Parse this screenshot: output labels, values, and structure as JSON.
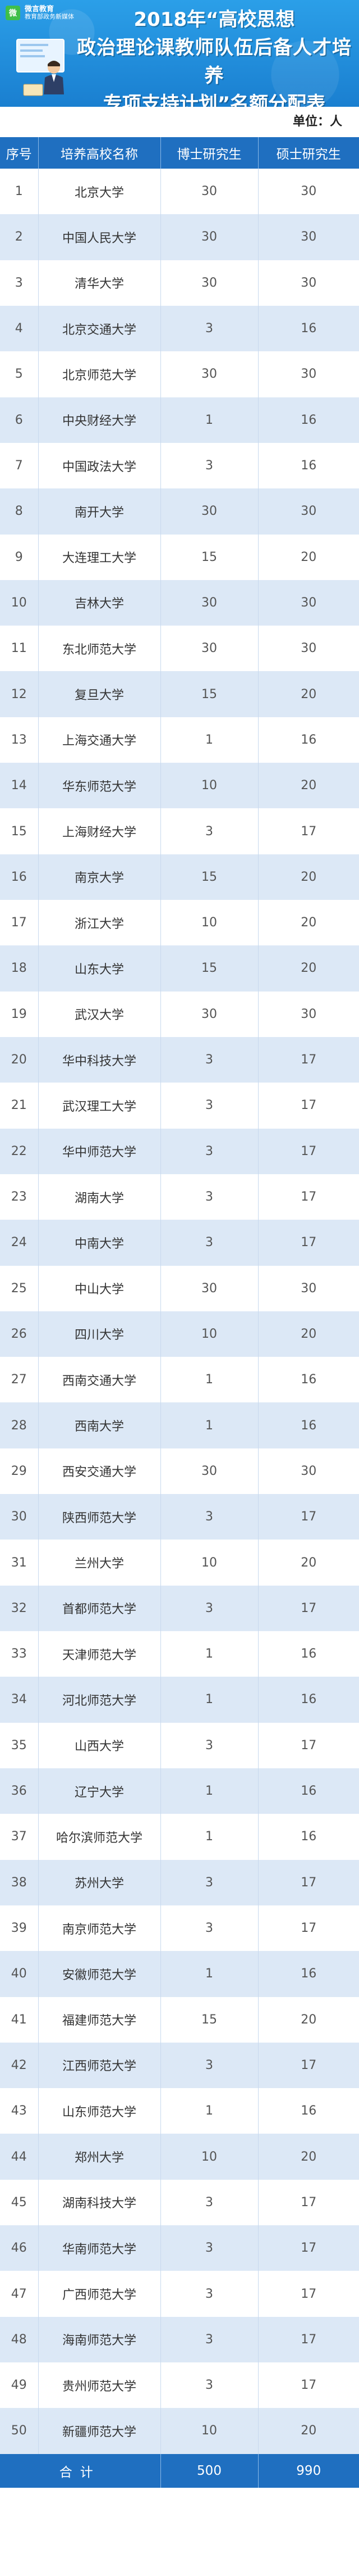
{
  "header": {
    "logo_line1": "微言教育",
    "logo_line2": "教育部政务新媒体",
    "title_line1": "2018年“高校思想",
    "title_line2": "政治理论课教师队伍后备人才培养",
    "title_line3": "专项支持计划”名额分配表",
    "colors": {
      "header_bg": "#1a7fd0",
      "table_header": "#1f6fc0",
      "stripe": "#dce8f6"
    }
  },
  "unit": "单位：人",
  "table": {
    "headers": [
      "序号",
      "培养高校名称",
      "博士研究生",
      "硕士研究生"
    ],
    "rows": [
      [
        "1",
        "北京大学",
        "30",
        "30"
      ],
      [
        "2",
        "中国人民大学",
        "30",
        "30"
      ],
      [
        "3",
        "清华大学",
        "30",
        "30"
      ],
      [
        "4",
        "北京交通大学",
        "3",
        "16"
      ],
      [
        "5",
        "北京师范大学",
        "30",
        "30"
      ],
      [
        "6",
        "中央财经大学",
        "1",
        "16"
      ],
      [
        "7",
        "中国政法大学",
        "3",
        "16"
      ],
      [
        "8",
        "南开大学",
        "30",
        "30"
      ],
      [
        "9",
        "大连理工大学",
        "15",
        "20"
      ],
      [
        "10",
        "吉林大学",
        "30",
        "30"
      ],
      [
        "11",
        "东北师范大学",
        "30",
        "30"
      ],
      [
        "12",
        "复旦大学",
        "15",
        "20"
      ],
      [
        "13",
        "上海交通大学",
        "1",
        "16"
      ],
      [
        "14",
        "华东师范大学",
        "10",
        "20"
      ],
      [
        "15",
        "上海财经大学",
        "3",
        "17"
      ],
      [
        "16",
        "南京大学",
        "15",
        "20"
      ],
      [
        "17",
        "浙江大学",
        "10",
        "20"
      ],
      [
        "18",
        "山东大学",
        "15",
        "20"
      ],
      [
        "19",
        "武汉大学",
        "30",
        "30"
      ],
      [
        "20",
        "华中科技大学",
        "3",
        "17"
      ],
      [
        "21",
        "武汉理工大学",
        "3",
        "17"
      ],
      [
        "22",
        "华中师范大学",
        "3",
        "17"
      ],
      [
        "23",
        "湖南大学",
        "3",
        "17"
      ],
      [
        "24",
        "中南大学",
        "3",
        "17"
      ],
      [
        "25",
        "中山大学",
        "30",
        "30"
      ],
      [
        "26",
        "四川大学",
        "10",
        "20"
      ],
      [
        "27",
        "西南交通大学",
        "1",
        "16"
      ],
      [
        "28",
        "西南大学",
        "1",
        "16"
      ],
      [
        "29",
        "西安交通大学",
        "30",
        "30"
      ],
      [
        "30",
        "陕西师范大学",
        "3",
        "17"
      ],
      [
        "31",
        "兰州大学",
        "10",
        "20"
      ],
      [
        "32",
        "首都师范大学",
        "3",
        "17"
      ],
      [
        "33",
        "天津师范大学",
        "1",
        "16"
      ],
      [
        "34",
        "河北师范大学",
        "1",
        "16"
      ],
      [
        "35",
        "山西大学",
        "3",
        "17"
      ],
      [
        "36",
        "辽宁大学",
        "1",
        "16"
      ],
      [
        "37",
        "哈尔滨师范大学",
        "1",
        "16"
      ],
      [
        "38",
        "苏州大学",
        "3",
        "17"
      ],
      [
        "39",
        "南京师范大学",
        "3",
        "17"
      ],
      [
        "40",
        "安徽师范大学",
        "1",
        "16"
      ],
      [
        "41",
        "福建师范大学",
        "15",
        "20"
      ],
      [
        "42",
        "江西师范大学",
        "3",
        "17"
      ],
      [
        "43",
        "山东师范大学",
        "1",
        "16"
      ],
      [
        "44",
        "郑州大学",
        "10",
        "20"
      ],
      [
        "45",
        "湖南科技大学",
        "3",
        "17"
      ],
      [
        "46",
        "华南师范大学",
        "3",
        "17"
      ],
      [
        "47",
        "广西师范大学",
        "3",
        "17"
      ],
      [
        "48",
        "海南师范大学",
        "3",
        "17"
      ],
      [
        "49",
        "贵州师范大学",
        "3",
        "17"
      ],
      [
        "50",
        "新疆师范大学",
        "10",
        "20"
      ]
    ],
    "total": {
      "label": "合计",
      "phd": "500",
      "master": "990"
    }
  }
}
